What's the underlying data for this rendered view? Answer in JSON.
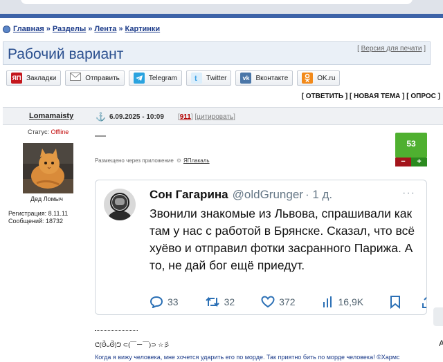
{
  "breadcrumb": {
    "items": [
      "Главная",
      "Разделы",
      "Лента",
      "Картинки"
    ],
    "separator": "»"
  },
  "page": {
    "title": "Рабочий вариант",
    "print_link": "Версия для печати"
  },
  "share": {
    "buttons": [
      {
        "label": "Закладки",
        "icon": "yaplakal-icon",
        "icon_text": "ЯП",
        "color": "#c4161c"
      },
      {
        "label": "Отправить",
        "icon": "mail-icon",
        "color": "#888888"
      },
      {
        "label": "Telegram",
        "icon": "telegram-icon",
        "color": "#2aa3df"
      },
      {
        "label": "Twitter",
        "icon": "twitter-icon",
        "color": "#3ea2e6"
      },
      {
        "label": "Вконтакте",
        "icon": "vk-icon",
        "icon_text": "vk",
        "color": "#4a76a8"
      },
      {
        "label": "OK.ru",
        "icon": "ok-icon",
        "color": "#f28a1b"
      }
    ]
  },
  "actions": [
    "ОТВЕТИТЬ",
    "НОВАЯ ТЕМА",
    "ОПРОС"
  ],
  "post": {
    "author": "Lomamaisty",
    "datetime": "6.09.2025 - 10:09",
    "number": "911",
    "quote_link": "цитировать",
    "status_label": "Статус:",
    "status_value": "Offline",
    "avatar_caption": "Дед Ломыч",
    "registration": "Регистрация: 8.11.11",
    "messages": "Сообщений: 18732",
    "body_text": "—",
    "via_text": "Размещено через приложение",
    "via_app": "ЯПлакаль",
    "rating": "53",
    "rating_minus": "−",
    "rating_plus": "+"
  },
  "tweet": {
    "name": "Сон Гагарина",
    "handle": "@oldGrunger",
    "time": "· 1 д.",
    "more": "···",
    "text": "Звонили знакомые из Львова, спрашивали как там у нас с работой в Брянске. Сказал, что всё хуёво и отправил фотки засранного Парижа. А то, не дай бог ещё приедут.",
    "replies": "33",
    "retweets": "32",
    "likes": "372",
    "views": "16,9K"
  },
  "signature": {
    "separator": "--------------------",
    "emoticon": "ᕦ(ʘ̚ᴗʘ̚)ᕤ ⊂(￣ー￣)⊃ ☆彡",
    "quote": "Когда я вижу человека, мне хочется ударить его по морде. Так приятно бить по морде человека! ©Хармс"
  },
  "right_edge": {
    "letter": "А"
  }
}
